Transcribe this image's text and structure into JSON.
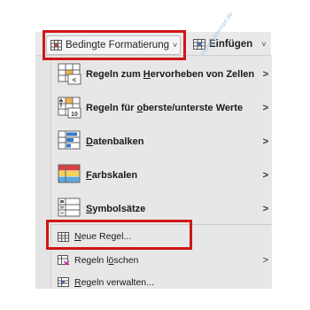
{
  "ribbon": {
    "conditional_formatting_label": "Bedingte Formatierung",
    "insert_label": "Einfügen",
    "dropdown_glyph": "˅"
  },
  "menu": {
    "items": [
      {
        "label": "Regeln zum Hervorheben von Zellen",
        "icon": "highlight-cells-rules-icon",
        "submenu": true
      },
      {
        "label": "Regeln für oberste/unterste Werte",
        "icon": "top-bottom-rules-icon",
        "submenu": true
      },
      {
        "label": "Datenbalken",
        "icon": "data-bars-icon",
        "submenu": true
      },
      {
        "label": "Farbskalen",
        "icon": "color-scales-icon",
        "submenu": true
      },
      {
        "label": "Symbolsätze",
        "icon": "icon-sets-icon",
        "submenu": true
      },
      {
        "label": "Neue Regel...",
        "icon": "new-rule-icon",
        "submenu": false
      },
      {
        "label": "Regeln löschen",
        "icon": "clear-rules-icon",
        "submenu": true
      },
      {
        "label": "Regeln verwalten...",
        "icon": "manage-rules-icon",
        "submenu": false
      }
    ],
    "submenu_arrow": ">"
  },
  "icon_badges": {
    "less_than": "<",
    "top_ten": "10"
  },
  "watermark": "Homeandsmart.de",
  "colors": {
    "highlight_border": "#d01616",
    "menu_bg": "#e7e7e7",
    "watermark": "#a9c8e8"
  }
}
